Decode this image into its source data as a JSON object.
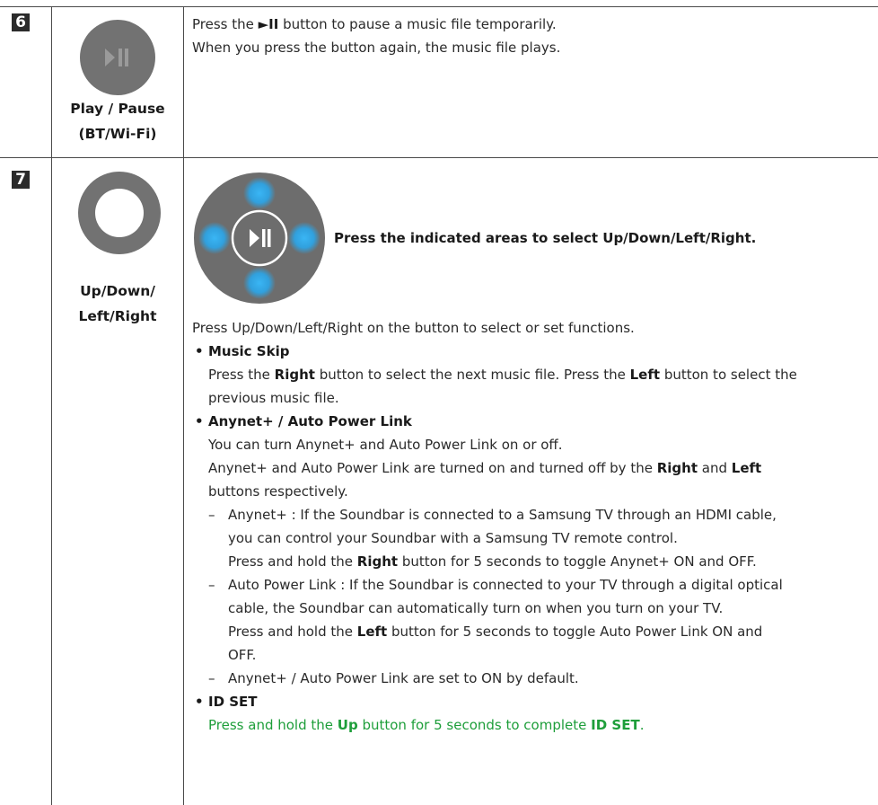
{
  "rows": [
    {
      "number": "6",
      "button_name_line1": "Play / Pause",
      "button_name_line2": "(BT/Wi-Fi)",
      "desc_pre": "Press the ",
      "desc_icon": "►II",
      "desc_post": " button to pause a music file temporarily.",
      "desc_line2": "When you press the button again, the music file plays."
    },
    {
      "number": "7",
      "button_name_line1": "Up/Down/",
      "button_name_line2": "Left/Right",
      "indicated_areas": "Press the indicated areas to select Up/Down/Left/Right.",
      "intro": "Press Up/Down/Left/Right on the button to select or set functions.",
      "music_skip": {
        "title": "Music Skip",
        "l1_a": "Press the ",
        "l1_b": "Right",
        "l1_c": " button to select the next music file. Press the ",
        "l1_d": "Left",
        "l1_e": " button to select the",
        "l2": "previous music file."
      },
      "anynet": {
        "title": "Anynet+ / Auto Power Link",
        "l1": "You can turn Anynet+ and Auto Power Link on or off.",
        "l2_a": "Anynet+ and Auto Power Link are turned on and turned off by the ",
        "l2_b": "Right",
        "l2_c": " and ",
        "l2_d": "Left",
        "l3": "buttons respectively.",
        "d1_l1": "Anynet+ : If the Soundbar is connected to a Samsung TV through an HDMI cable,",
        "d1_l2": "you can control your Soundbar with a Samsung TV remote control.",
        "d1_l3_a": "Press and hold the ",
        "d1_l3_b": "Right",
        "d1_l3_c": " button for 5 seconds to toggle Anynet+ ON and OFF.",
        "d2_l1": "Auto Power Link : If the Soundbar is connected to your TV through a digital optical",
        "d2_l2": "cable, the Soundbar can automatically turn on when you turn on your TV.",
        "d2_l3_a": "Press and hold the ",
        "d2_l3_b": "Left",
        "d2_l3_c": " button for 5 seconds to toggle Auto Power Link ON and",
        "d2_l4": "OFF.",
        "d3": "Anynet+ / Auto Power Link are set to ON by default."
      },
      "id_set": {
        "title": "ID SET",
        "l1_a": "Press and hold the ",
        "l1_b": "Up",
        "l1_c": " button for 5 seconds to complete ",
        "l1_d": "ID SET",
        "l1_e": "."
      }
    }
  ],
  "colors": {
    "accent_green": "#1e9e3a",
    "dpad_glow": "#2aa6ea",
    "button_gray": "#707070"
  }
}
